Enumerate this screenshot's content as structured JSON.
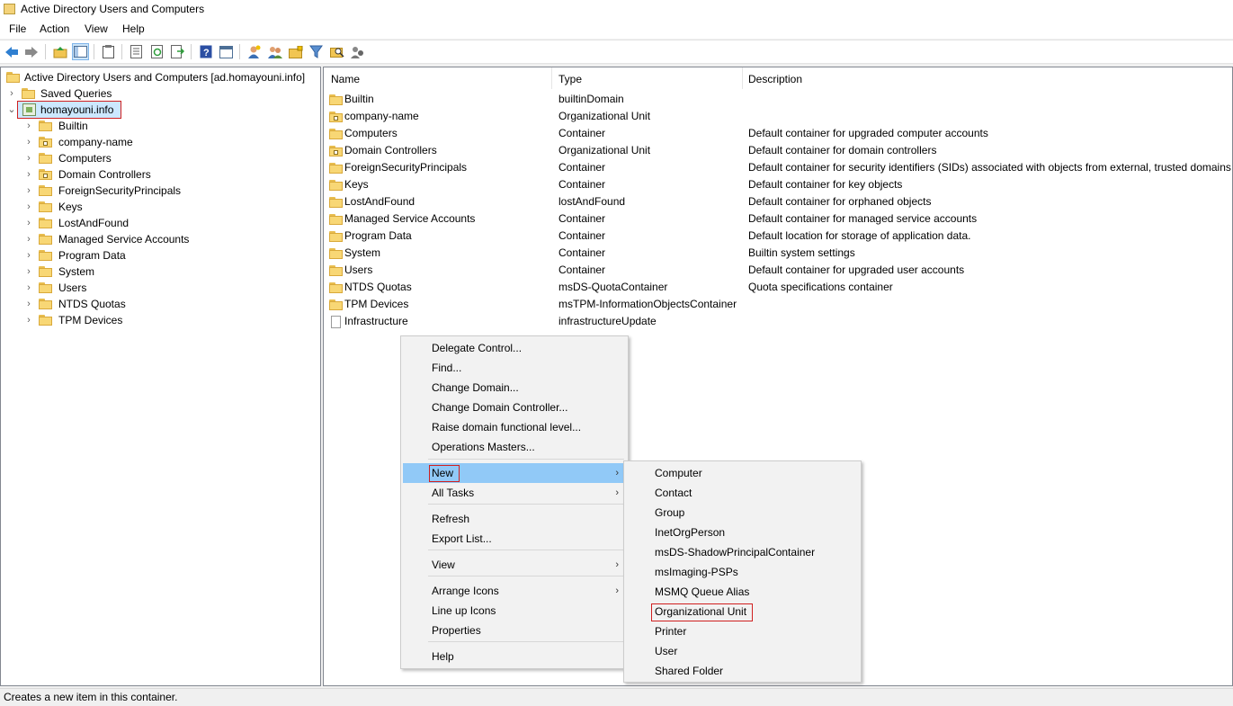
{
  "window": {
    "title": "Active Directory Users and Computers"
  },
  "menubar": [
    "File",
    "Action",
    "View",
    "Help"
  ],
  "toolbar_icons": [
    "back-arrow-icon",
    "forward-arrow-icon",
    "up-folder-icon",
    "show-hide-tree-icon",
    "clipboard-icon",
    "properties-icon",
    "refresh-icon",
    "export-list-icon",
    "help-icon",
    "console-icon",
    "add-user-icon",
    "add-group-icon",
    "add-ou-icon",
    "filter-icon",
    "find-icon",
    "delegate-icon"
  ],
  "tree": {
    "root": "Active Directory Users and Computers [ad.homayouni.info]",
    "saved_queries": "Saved Queries",
    "domain": "homayouni.info",
    "children": [
      "Builtin",
      "company-name",
      "Computers",
      "Domain Controllers",
      "ForeignSecurityPrincipals",
      "Keys",
      "LostAndFound",
      "Managed Service Accounts",
      "Program Data",
      "System",
      "Users",
      "NTDS Quotas",
      "TPM Devices"
    ]
  },
  "list": {
    "columns": [
      "Name",
      "Type",
      "Description"
    ],
    "rows": [
      {
        "name": "Builtin",
        "type": "builtinDomain",
        "description": ""
      },
      {
        "name": "company-name",
        "type": "Organizational Unit",
        "description": ""
      },
      {
        "name": "Computers",
        "type": "Container",
        "description": "Default container for upgraded computer accounts"
      },
      {
        "name": "Domain Controllers",
        "type": "Organizational Unit",
        "description": "Default container for domain controllers"
      },
      {
        "name": "ForeignSecurityPrincipals",
        "type": "Container",
        "description": "Default container for security identifiers (SIDs) associated with objects from external, trusted domains"
      },
      {
        "name": "Keys",
        "type": "Container",
        "description": "Default container for key objects"
      },
      {
        "name": "LostAndFound",
        "type": "lostAndFound",
        "description": "Default container for orphaned objects"
      },
      {
        "name": "Managed Service Accounts",
        "type": "Container",
        "description": "Default container for managed service accounts"
      },
      {
        "name": "Program Data",
        "type": "Container",
        "description": "Default location for storage of application data."
      },
      {
        "name": "System",
        "type": "Container",
        "description": "Builtin system settings"
      },
      {
        "name": "Users",
        "type": "Container",
        "description": "Default container for upgraded user accounts"
      },
      {
        "name": "NTDS Quotas",
        "type": "msDS-QuotaContainer",
        "description": "Quota specifications container"
      },
      {
        "name": "TPM Devices",
        "type": "msTPM-InformationObjectsContainer",
        "description": ""
      },
      {
        "name": "Infrastructure",
        "type": "infrastructureUpdate",
        "description": ""
      }
    ]
  },
  "context_menu": {
    "items": [
      "Delegate Control...",
      "Find...",
      "Change Domain...",
      "Change Domain Controller...",
      "Raise domain functional level...",
      "Operations Masters...",
      "New",
      "All Tasks",
      "Refresh",
      "Export List...",
      "View",
      "Arrange Icons",
      "Line up Icons",
      "Properties",
      "Help"
    ]
  },
  "new_submenu": {
    "items": [
      "Computer",
      "Contact",
      "Group",
      "InetOrgPerson",
      "msDS-ShadowPrincipalContainer",
      "msImaging-PSPs",
      "MSMQ Queue Alias",
      "Organizational Unit",
      "Printer",
      "User",
      "Shared Folder"
    ]
  },
  "status": "Creates a new item in this container."
}
